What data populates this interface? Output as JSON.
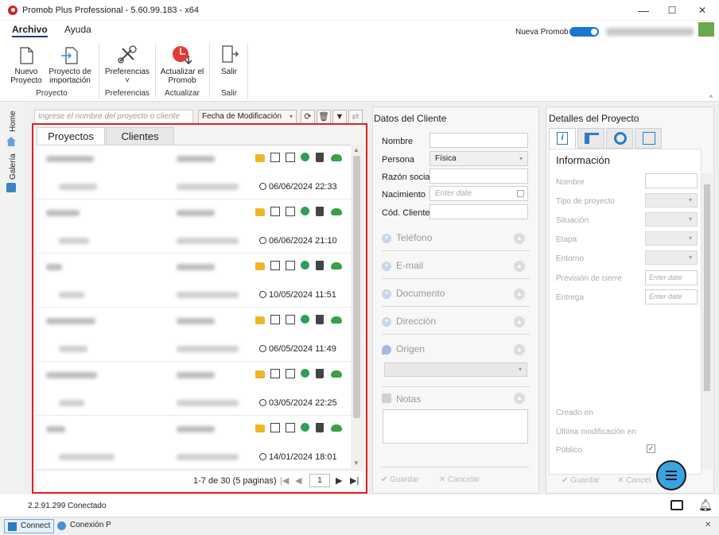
{
  "window": {
    "title": "Promob Plus Professional - 5.60.99.183 - x64",
    "minimize": "—",
    "maximize": "☐",
    "close": "✕"
  },
  "menu": {
    "items": [
      "Archivo",
      "Ayuda"
    ],
    "toggle_label": "Nueva Promob"
  },
  "ribbon": {
    "groups": [
      {
        "label": "Proyecto",
        "buttons": [
          {
            "label": "Nuevo Proyecto",
            "icon": "new-file-icon"
          },
          {
            "label": "Proyecto de importación",
            "icon": "import-file-icon"
          }
        ]
      },
      {
        "label": "Preferencias",
        "buttons": [
          {
            "label": "Preferencias",
            "icon": "tools-icon"
          }
        ]
      },
      {
        "label": "Actualizar",
        "buttons": [
          {
            "label": "Actualizar el Promob",
            "icon": "update-icon"
          }
        ]
      },
      {
        "label": "Salir",
        "buttons": [
          {
            "label": "Salir",
            "icon": "exit-icon"
          }
        ]
      }
    ],
    "pref_caret": "˅",
    "collapse": "^"
  },
  "sidebar": {
    "tabs": [
      {
        "label": "Home",
        "icon": "home-icon"
      },
      {
        "label": "Galería",
        "icon": "gallery-icon"
      }
    ]
  },
  "projects": {
    "search_placeholder": "Ingrese el nombre del proyecto o cliente",
    "sort_label": "Fecha de Modificación",
    "tabs": [
      "Proyectos",
      "Clientes"
    ],
    "rows": [
      {
        "date": "06/06/2024 22:33"
      },
      {
        "date": "06/06/2024 21:10"
      },
      {
        "date": "10/05/2024 11:51"
      },
      {
        "date": "06/05/2024 11:49"
      },
      {
        "date": "03/05/2024 22:25"
      },
      {
        "date": "14/01/2024 18:01"
      }
    ],
    "pager": {
      "summary": "1-7 de 30 (5 paginas)",
      "page": "1"
    },
    "colors": {
      "highlight": "#e02020",
      "folder": "#f0b429",
      "share": "#2f9e58",
      "cloud": "#3aa14a"
    }
  },
  "client": {
    "title": "Datos del Cliente",
    "fields": {
      "nombre": "Nombre",
      "persona": "Persona",
      "persona_value": "Física",
      "razon": "Razón social",
      "nacimiento": "Nacimiento",
      "nacimiento_placeholder": "Enter date",
      "cod": "Cód. Cliente"
    },
    "sections": [
      "Teléfono",
      "E-mail",
      "Documento",
      "Dirección",
      "Origen",
      "Notas"
    ],
    "save": "Guardar",
    "cancel": "Cancelar"
  },
  "details": {
    "title": "Detalles del Proyecto",
    "section": "Información",
    "fields": {
      "nombre": "Nombre",
      "tipo": "Tipo de proyecto",
      "situacion": "Situación",
      "etapa": "Etapa",
      "entorno": "Entorno",
      "prevision": "Previsión de cierre",
      "entrega": "Entrega",
      "creado": "Creado en",
      "ultima": "Última modificación en",
      "publico": "Público"
    },
    "date_placeholder": "Enter date",
    "save": "Guardar",
    "cancel": "Cancel"
  },
  "status": {
    "text": "2.2.91.299 Conectado"
  },
  "taskbar": {
    "items": [
      "Connect",
      "Conexión P"
    ]
  }
}
